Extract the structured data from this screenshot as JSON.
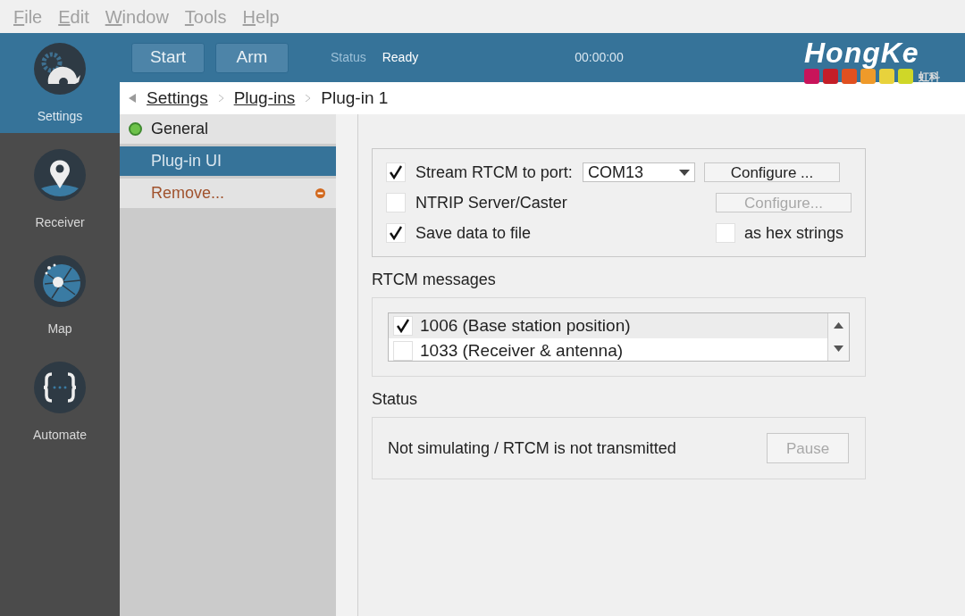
{
  "menu": [
    {
      "label": "File"
    },
    {
      "label": "Edit"
    },
    {
      "label": "Window"
    },
    {
      "label": "Tools"
    },
    {
      "label": "Help"
    }
  ],
  "nav": [
    {
      "label": "Settings",
      "kind": "gear",
      "selected": true
    },
    {
      "label": "Receiver",
      "kind": "pin",
      "selected": false
    },
    {
      "label": "Map",
      "kind": "globe",
      "selected": false
    },
    {
      "label": "Automate",
      "kind": "braces",
      "selected": false
    }
  ],
  "toolbar": {
    "buttons": [
      "Start",
      "Arm"
    ],
    "status_label": "Status",
    "status_value": "Ready",
    "timer": "00:00:00",
    "logo": "HongKe",
    "logo_sub": "虹科"
  },
  "breadcrumb": [
    {
      "label": "Settings",
      "link": true
    },
    {
      "label": "Plug-ins",
      "link": true
    },
    {
      "label": "Plug-in 1",
      "link": false
    }
  ],
  "side_list": [
    {
      "label": "General",
      "kind": "status",
      "selected": false
    },
    {
      "label": "Plug-in UI",
      "kind": "plain",
      "selected": true
    },
    {
      "label": "Remove...",
      "kind": "remove",
      "selected": false
    }
  ],
  "options": {
    "stream": {
      "label": "Stream RTCM to port:",
      "checked": true,
      "port": "COM13",
      "button": "Configure ...",
      "button_disabled": false
    },
    "ntrip": {
      "label": "NTRIP Server/Caster",
      "checked": false,
      "button": "Configure...",
      "button_disabled": true
    },
    "save": {
      "label": "Save data to file",
      "checked": true
    },
    "hex": {
      "label": "as hex strings",
      "checked": false
    }
  },
  "messages": {
    "title": "RTCM messages",
    "items": [
      {
        "label": "1006 (Base station position)",
        "checked": true,
        "selected": true
      },
      {
        "label": "1033 (Receiver & antenna)",
        "checked": false,
        "selected": false
      }
    ]
  },
  "status": {
    "title": "Status",
    "text": "Not simulating / RTCM is not transmitted",
    "button": "Pause",
    "button_disabled": true
  }
}
